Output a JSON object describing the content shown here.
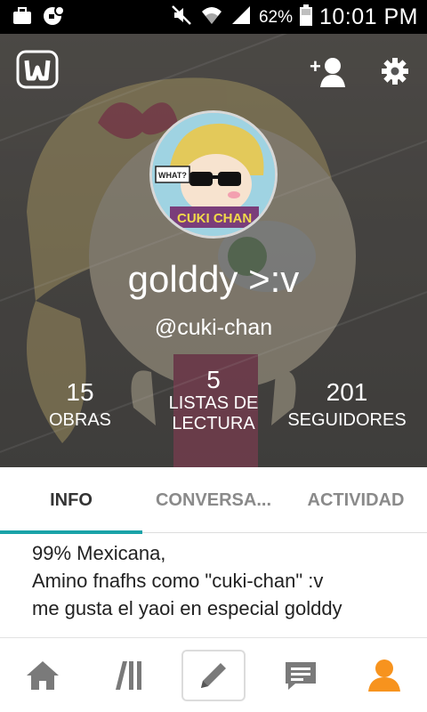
{
  "status_bar": {
    "battery_percent": "62%",
    "time": "10:01 PM"
  },
  "profile": {
    "display_name": "golddy >:v",
    "username": "@cuki-chan",
    "avatar_text_top": "WHAT?",
    "avatar_text_bottom": "CUKI CHAN"
  },
  "stats": [
    {
      "value": "15",
      "label": "OBRAS"
    },
    {
      "value": "5",
      "label": "LISTAS DE LECTURA"
    },
    {
      "value": "201",
      "label": "SEGUIDORES"
    }
  ],
  "tabs": [
    {
      "label": "INFO",
      "active": true
    },
    {
      "label": "CONVERSA...",
      "active": false
    },
    {
      "label": "ACTIVIDAD",
      "active": false
    }
  ],
  "about": {
    "lines": [
      "99% Mexicana,",
      "Amino fnafhs como \"cuki-chan\" :v",
      "me gusta el yaoi en especial golddy"
    ]
  },
  "colors": {
    "accent_teal": "#1aa3a8",
    "active_nav_orange": "#f7931e",
    "nav_gray": "#7a7a7a"
  },
  "icons": {
    "app_logo": "wattpad-logo-icon",
    "add_friend": "add-person-icon",
    "settings": "gear-icon",
    "nav": [
      "home-icon",
      "library-icon",
      "pencil-icon",
      "messages-icon",
      "profile-icon"
    ]
  }
}
